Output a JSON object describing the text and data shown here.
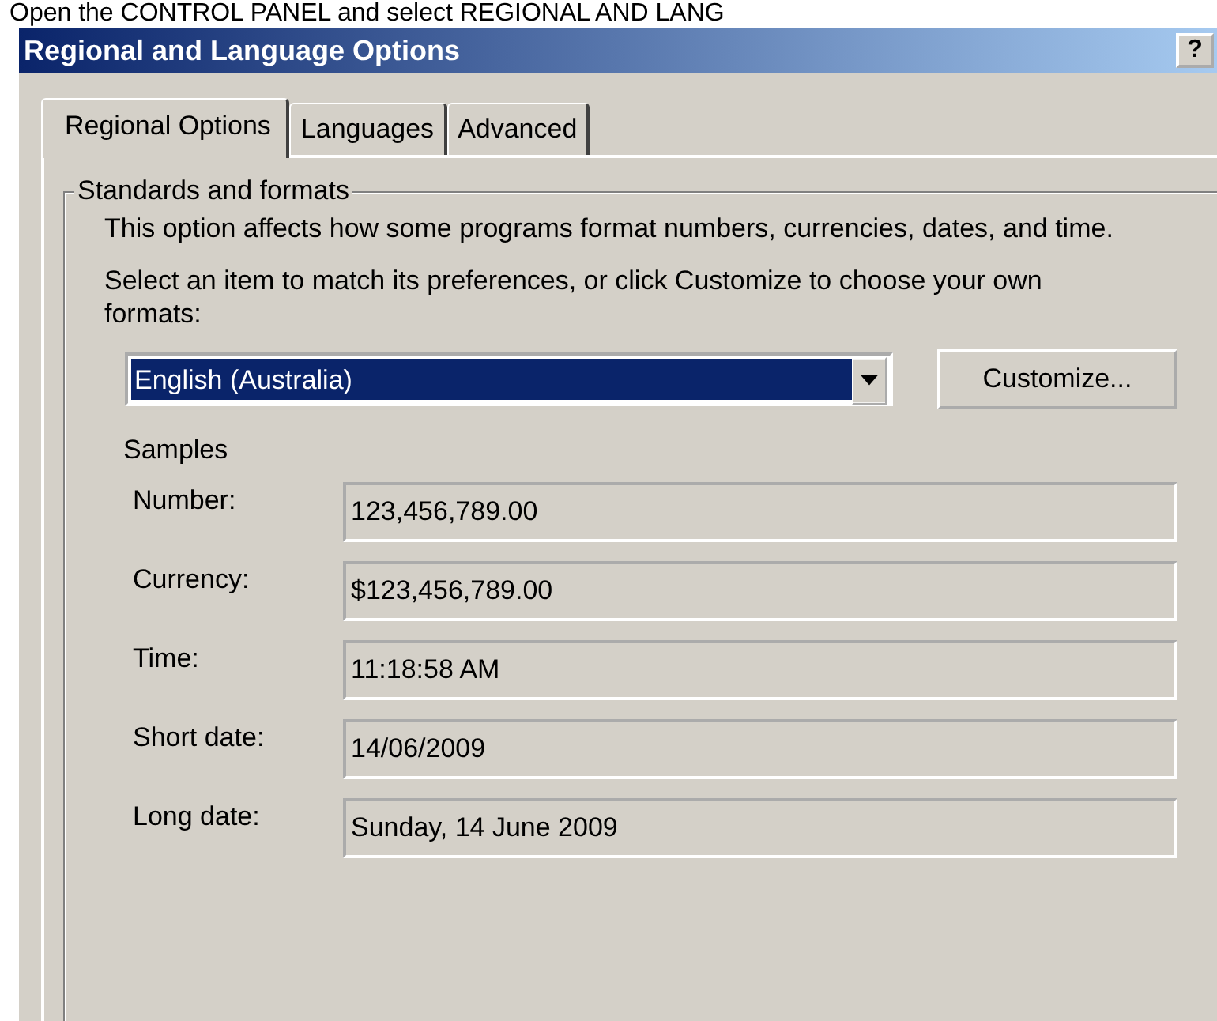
{
  "caption": "Open the CONTROL PANEL and select REGIONAL AND LANG",
  "window": {
    "title": "Regional and Language Options",
    "help_button": "?"
  },
  "tabs": [
    {
      "label": "Regional Options",
      "selected": true
    },
    {
      "label": "Languages",
      "selected": false
    },
    {
      "label": "Advanced",
      "selected": false
    }
  ],
  "standards": {
    "title": "Standards and formats",
    "description": "This option affects how some programs format numbers, currencies, dates, and time.",
    "instruction": "Select an item to match its preferences, or click Customize to choose your own formats:",
    "locale": "English (Australia)",
    "customize_button": "Customize...",
    "samples_label": "Samples",
    "samples": [
      {
        "label": "Number:",
        "value": "123,456,789.00"
      },
      {
        "label": "Currency:",
        "value": "$123,456,789.00"
      },
      {
        "label": "Time:",
        "value": "11:18:58 AM"
      },
      {
        "label": "Short date:",
        "value": "14/06/2009"
      },
      {
        "label": "Long date:",
        "value": "Sunday, 14 June 2009"
      }
    ]
  }
}
